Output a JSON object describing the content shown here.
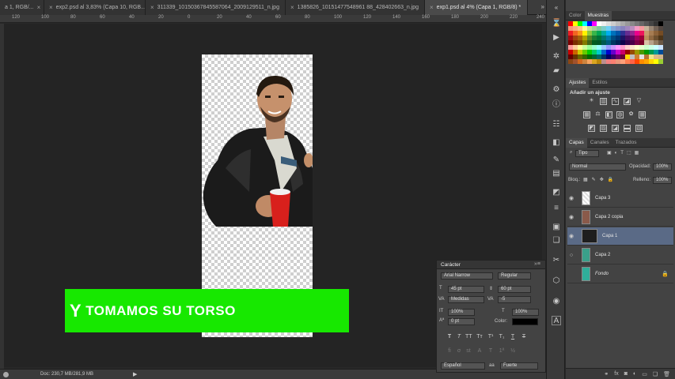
{
  "tabs": [
    {
      "label": "a 1, RGB/...",
      "active": false
    },
    {
      "label": "exp2.psd al 3,83% (Capa 10, RGB...",
      "active": false
    },
    {
      "label": "311339_10150367845587064_2009129511_n.jpg",
      "active": false
    },
    {
      "label": "1385826_10151477548961 88_428402663_n.jpg",
      "active": false
    },
    {
      "label": "exp1.psd al 4% (Capa 1, RGB/8) *",
      "active": true
    }
  ],
  "ruler_ticks": [
    "120",
    "100",
    "80",
    "60",
    "40",
    "20",
    "0",
    "20",
    "40",
    "60",
    "80",
    "100",
    "120",
    "140",
    "160",
    "180",
    "200",
    "220",
    "240"
  ],
  "caption": {
    "first": "Y",
    "rest": "TOMAMOS SU TORSO"
  },
  "status": {
    "doc_size": "Doc: 230,7 MB/281,9 MB"
  },
  "color_panel": {
    "tabs": [
      "Color",
      "Muestras"
    ],
    "active": "Muestras"
  },
  "adjust_panel": {
    "tabs": [
      "Ajustes",
      "Estilos"
    ],
    "title": "Añadir un ajuste"
  },
  "layers_panel": {
    "tabs": [
      "Capas",
      "Canales",
      "Trazados"
    ],
    "kind_filter": "Tipo",
    "blend_mode": "Normal",
    "opacity_label": "Opacidad:",
    "opacity": "100%",
    "lock_label": "Bloq.:",
    "fill_label": "Relleno:",
    "fill": "100%",
    "layers": [
      {
        "name": "Capa 3",
        "visible": true,
        "selected": false
      },
      {
        "name": "Capa 2 copia",
        "visible": true,
        "selected": false
      },
      {
        "name": "Capa 1",
        "visible": true,
        "selected": true
      },
      {
        "name": "Capa 2",
        "visible": false,
        "selected": false
      },
      {
        "name": "Fondo",
        "visible": false,
        "selected": false,
        "locked": true
      }
    ]
  },
  "character_panel": {
    "title": "Carácter",
    "font_family": "Arial Narrow",
    "font_style": "Regular",
    "font_size": "45 pt",
    "leading": "60 pt",
    "kerning": "Medidas",
    "tracking": "-5",
    "vertical_scale": "100%",
    "horizontal_scale": "100%",
    "baseline_shift": "0 pt",
    "color_label": "Color:",
    "language": "Español",
    "antialias": "Fuerte"
  },
  "colors": {
    "caption_bg": "#17e800",
    "selected_layer": "#5a6a86",
    "swatches": [
      "#ff0000",
      "#ffff00",
      "#00ff00",
      "#00ffff",
      "#0000ff",
      "#ff00ff",
      "#ffffff",
      "#eeeeee",
      "#dddddd",
      "#cccccc",
      "#bbbbbb",
      "#aaaaaa",
      "#999999",
      "#888888",
      "#777777",
      "#666666",
      "#555555",
      "#444444",
      "#333333",
      "#000000",
      "#f7977a",
      "#f9ad81",
      "#fdc68a",
      "#fff79a",
      "#c4df9b",
      "#a3d39c",
      "#82ca9d",
      "#7bcdc8",
      "#6ecff6",
      "#7ea7d8",
      "#8493ca",
      "#8882be",
      "#a187be",
      "#bc8dbf",
      "#f49ac2",
      "#f6989d",
      "#c7b299",
      "#998675",
      "#736357",
      "#534741",
      "#ed1c24",
      "#f26522",
      "#f7941d",
      "#fff200",
      "#8dc63f",
      "#39b54a",
      "#00a651",
      "#00a99d",
      "#00aeef",
      "#0072bc",
      "#0054a6",
      "#2e3192",
      "#662d91",
      "#92278f",
      "#ec008c",
      "#ed145b",
      "#c69c6d",
      "#a67c52",
      "#8c6239",
      "#754c24",
      "#9e0b0f",
      "#a0410d",
      "#a3620a",
      "#aba000",
      "#598527",
      "#1a7b30",
      "#007236",
      "#00746b",
      "#0076a3",
      "#004b80",
      "#003471",
      "#1b1464",
      "#440e62",
      "#630460",
      "#9e005d",
      "#9e0039",
      "#ba8f5a",
      "#8f6942",
      "#6c4f2f",
      "#4d3518",
      "#790000",
      "#7b2e00",
      "#7d4900",
      "#827b00",
      "#406618",
      "#005e20",
      "#005826",
      "#005952",
      "#005b7f",
      "#003663",
      "#002157",
      "#0d004c",
      "#32004b",
      "#4b0049",
      "#7b0046",
      "#7a0026",
      "#d8c3a5",
      "#b8a089",
      "#937b61",
      "#6a5744",
      "#ff9999",
      "#ffcc99",
      "#ffff99",
      "#ccff99",
      "#99ff99",
      "#99ffcc",
      "#99ffff",
      "#99ccff",
      "#9999ff",
      "#cc99ff",
      "#ff99ff",
      "#ff99cc",
      "#ffcccc",
      "#ffe5cc",
      "#ffffcc",
      "#e5ffcc",
      "#ccffcc",
      "#ccffe5",
      "#ccffff",
      "#cce5ff",
      "#cc0000",
      "#cc6600",
      "#cccc00",
      "#66cc00",
      "#00cc00",
      "#00cc66",
      "#00cccc",
      "#0066cc",
      "#0000cc",
      "#6600cc",
      "#cc00cc",
      "#cc0066",
      "#990000",
      "#994c00",
      "#999900",
      "#4c9900",
      "#009900",
      "#00994c",
      "#009999",
      "#004c99",
      "#660000",
      "#663300",
      "#666600",
      "#336600",
      "#006600",
      "#006633",
      "#006666",
      "#003366",
      "#000066",
      "#330066",
      "#660066",
      "#660033",
      "#ffd700",
      "#c0c0c0",
      "#cd7f32",
      "#e5e4e2",
      "#b87333",
      "#f0e68c",
      "#deb887",
      "#d2b48c",
      "#8b4513",
      "#a0522d",
      "#d2691e",
      "#cd853f",
      "#f4a460",
      "#daa520",
      "#b8860b",
      "#bc8f8f",
      "#f08080",
      "#fa8072",
      "#e9967a",
      "#ffa07a",
      "#ff7f50",
      "#ff6347",
      "#ff4500",
      "#ff8c00",
      "#ffa500",
      "#ffd700",
      "#ffff00",
      "#9acd32"
    ]
  }
}
